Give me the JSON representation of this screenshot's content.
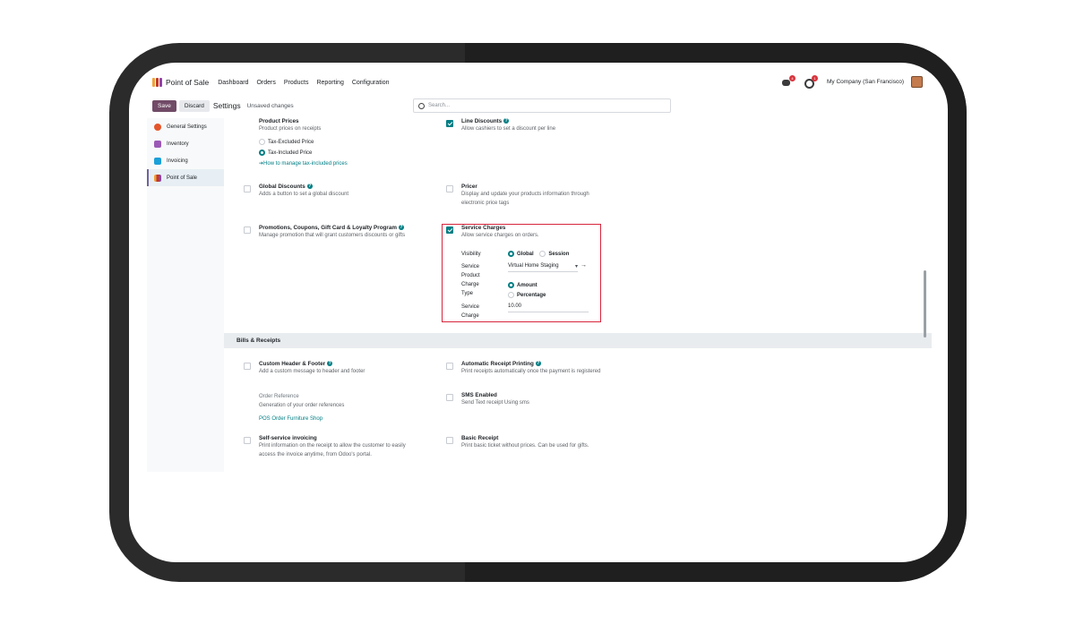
{
  "navbar": {
    "app_name": "Point of Sale",
    "menu": [
      "Dashboard",
      "Orders",
      "Products",
      "Reporting",
      "Configuration"
    ],
    "chat_badge": "4",
    "activity_badge": "1",
    "company": "My Company (San Francisco)"
  },
  "controls": {
    "save_label": "Save",
    "discard_label": "Discard",
    "breadcrumb": "Settings",
    "status": "Unsaved changes",
    "search_placeholder": "Search..."
  },
  "sidebar": {
    "items": [
      {
        "label": "General Settings",
        "color": "#e5542a"
      },
      {
        "label": "Inventory",
        "color": "#9b59b6"
      },
      {
        "label": "Invoicing",
        "color": "#1ba0d8"
      },
      {
        "label": "Point of Sale",
        "color": "#c0392b"
      }
    ]
  },
  "settings": {
    "product_prices": {
      "title": "Product Prices",
      "desc": "Product prices on receipts",
      "options": [
        "Tax-Excluded Price",
        "Tax-Included Price"
      ],
      "selected": "Tax-Included Price",
      "link": "How to manage tax-included prices"
    },
    "line_discounts": {
      "title": "Line Discounts",
      "desc": "Allow cashiers to set a discount per line",
      "checked": true
    },
    "global_discounts": {
      "title": "Global Discounts",
      "desc": "Adds a button to set a global discount",
      "checked": false
    },
    "pricer": {
      "title": "Pricer",
      "desc1": "Display and update your products information through",
      "desc2": "electronic price tags",
      "checked": false
    },
    "promotions": {
      "title": "Promotions, Coupons, Gift Card & Loyalty Program",
      "desc": "Manage promotion that will grant customers discounts or gifts",
      "checked": false
    },
    "service_charges": {
      "title": "Service Charges",
      "desc": "Allow service charges on orders.",
      "checked": true,
      "visibility_label": "Visibility",
      "visibility_options": [
        "Global",
        "Session"
      ],
      "visibility_selected": "Global",
      "service_product_label1": "Service",
      "service_product_label2": "Product",
      "service_product_value": "Virtual Home Staging",
      "charge_type_label1": "Charge",
      "charge_type_label2": "Type",
      "charge_type_options": [
        "Amount",
        "Percentage"
      ],
      "charge_type_selected": "Amount",
      "service_charge_label1": "Service",
      "service_charge_label2": "Charge",
      "service_charge_value": "10.00"
    },
    "section_bills": "Bills & Receipts",
    "custom_header": {
      "title": "Custom Header & Footer",
      "desc": "Add a custom message to header and footer",
      "checked": false
    },
    "auto_receipt": {
      "title": "Automatic Receipt Printing",
      "desc": "Print receipts automatically once the payment is registered",
      "checked": false
    },
    "order_reference": {
      "title": "Order Reference",
      "desc": "Generation of your order references",
      "link": "POS Order Furniture Shop"
    },
    "sms": {
      "title": "SMS Enabled",
      "desc": "Send Text receipt Using sms",
      "checked": false
    },
    "self_invoicing": {
      "title": "Self-service invoicing",
      "desc1": "Print information on the receipt to allow the customer to easily",
      "desc2": "access the invoice anytime, from Odoo's portal.",
      "checked": false
    },
    "basic_receipt": {
      "title": "Basic Receipt",
      "desc": "Print basic ticket without prices. Can be used for gifts.",
      "checked": false
    }
  },
  "colors": {
    "brand": "#714b67",
    "accent": "#017e84",
    "highlight": "#d7263d"
  }
}
